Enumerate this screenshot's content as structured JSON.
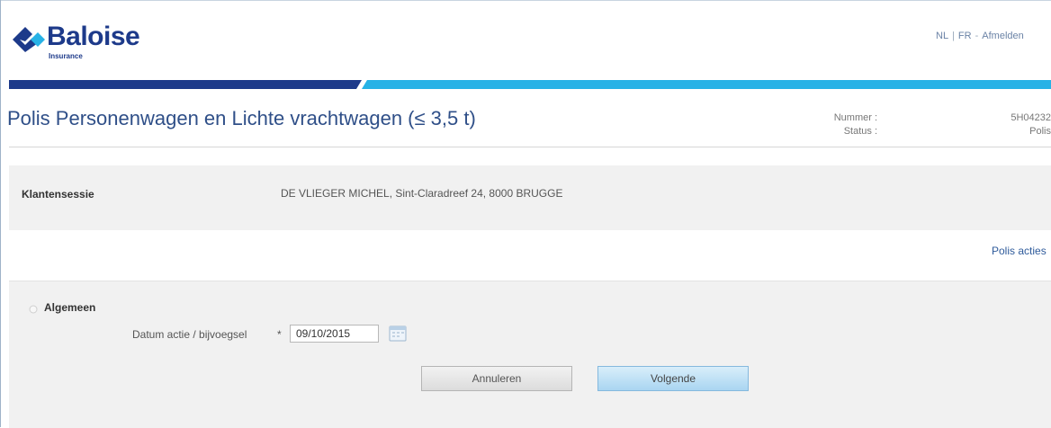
{
  "brand": {
    "name": "Baloise",
    "tagline": "Insurance",
    "colors": {
      "navy": "#1d3a8a",
      "cyan": "#27b2e6"
    }
  },
  "header": {
    "languages": [
      "NL",
      "FR"
    ],
    "logout_label": "Afmelden"
  },
  "policy": {
    "title": "Polis Personenwagen en Lichte vrachtwagen (≤ 3,5 t)",
    "number_label": "Nummer :",
    "status_label": "Status :",
    "number_value": "5H04232",
    "status_value": "Polis"
  },
  "session": {
    "label": "Klantensessie",
    "value": "DE VLIEGER MICHEL, Sint-Claradreef 24, 8000 BRUGGE"
  },
  "actions_link": "Polis acties",
  "form": {
    "section_title": "Algemeen",
    "date_label": "Datum actie / bijvoegsel",
    "required_marker": "*",
    "date_value": "09/10/2015",
    "cancel_label": "Annuleren",
    "next_label": "Volgende"
  },
  "icons": [
    "baloise-logo-icon",
    "radio-toggle-icon",
    "calendar-icon"
  ]
}
